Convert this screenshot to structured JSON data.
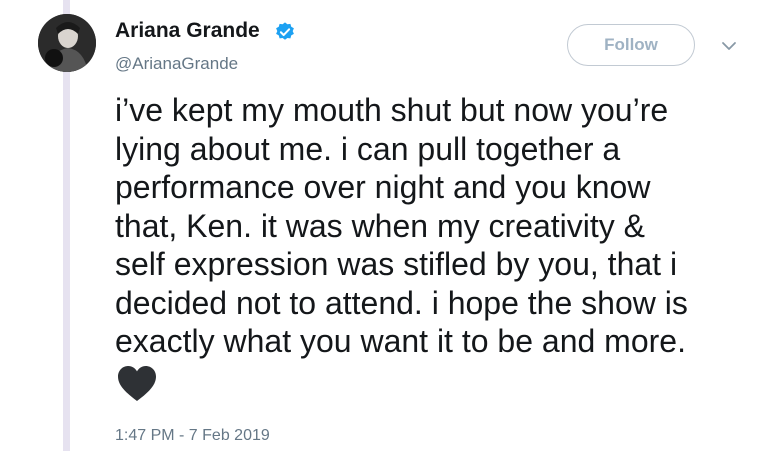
{
  "author": {
    "name": "Ariana Grande",
    "handle": "@ArianaGrande",
    "verified": true
  },
  "follow_button_label": "Follow",
  "tweet": {
    "lines": [
      "i’ve kept my mouth shut but now you’re",
      "lying about me. i can pull together a",
      "performance over night and you know",
      "that, Ken. it was when my creativity &",
      "self expression was stifled by you, that i",
      "decided not to attend. i hope the show is",
      "exactly what you want it to be and more."
    ],
    "emoji": "black-heart-icon",
    "timestamp": "1:47 PM - 7 Feb 2019"
  },
  "colors": {
    "text": "#14171a",
    "secondary_text": "#657786",
    "verified_blue": "#1da1f2",
    "follow_border": "#c2cad3",
    "thread_line": "#e6e2f0"
  }
}
